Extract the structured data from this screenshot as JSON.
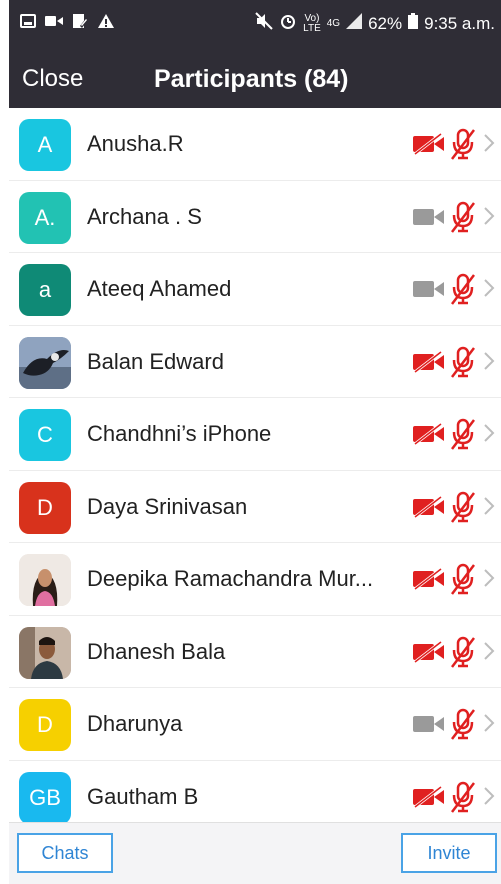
{
  "status_bar": {
    "battery": "62%",
    "time": "9:35 a.m.",
    "network_top": "Vo)",
    "network_bottom": "LTE",
    "data_top": "4G",
    "icons": [
      "gallery-icon",
      "video-icon",
      "edit-icon",
      "alert-icon",
      "mute-icon",
      "alarm-icon",
      "signal-icon",
      "battery-icon"
    ]
  },
  "header": {
    "close_label": "Close",
    "title": "Participants (84)"
  },
  "colors": {
    "header_bg": "#2f2d36",
    "muted_red": "#e02020",
    "video_gray": "#9a9a9a",
    "accent_blue": "#2f85d4"
  },
  "participants": [
    {
      "name": "Anusha.R",
      "avatar_text": "A",
      "avatar_color": "#19c6e0",
      "video": "off",
      "mic": "muted"
    },
    {
      "name": "Archana . S",
      "avatar_text": "A.",
      "avatar_color": "#22c2b3",
      "video": "on",
      "mic": "muted"
    },
    {
      "name": "Ateeq Ahamed",
      "avatar_text": "a",
      "avatar_color": "#0f8a76",
      "video": "on",
      "mic": "muted"
    },
    {
      "name": "Balan Edward",
      "avatar_text": "",
      "avatar_color": "#7b8fa8",
      "avatar_photo": "eagle-photo",
      "video": "off",
      "mic": "muted"
    },
    {
      "name": "Chandhni’s iPhone",
      "avatar_text": "C",
      "avatar_color": "#19c6e0",
      "video": "off",
      "mic": "muted"
    },
    {
      "name": "Daya Srinivasan",
      "avatar_text": "D",
      "avatar_color": "#d8321c",
      "video": "off",
      "mic": "muted"
    },
    {
      "name": "Deepika Ramachandra Mur...",
      "avatar_text": "",
      "avatar_color": "#e9e1dc",
      "avatar_photo": "woman-photo",
      "video": "off",
      "mic": "muted"
    },
    {
      "name": "Dhanesh Bala",
      "avatar_text": "",
      "avatar_color": "#b8a79a",
      "avatar_photo": "man-photo",
      "video": "off",
      "mic": "muted"
    },
    {
      "name": "Dharunya",
      "avatar_text": "D",
      "avatar_color": "#f6d000",
      "video": "on",
      "mic": "muted"
    },
    {
      "name": "Gautham B",
      "avatar_text": "GB",
      "avatar_color": "#19b9ef",
      "video": "off",
      "mic": "muted"
    }
  ],
  "footer": {
    "chats_label": "Chats",
    "invite_label": "Invite"
  }
}
